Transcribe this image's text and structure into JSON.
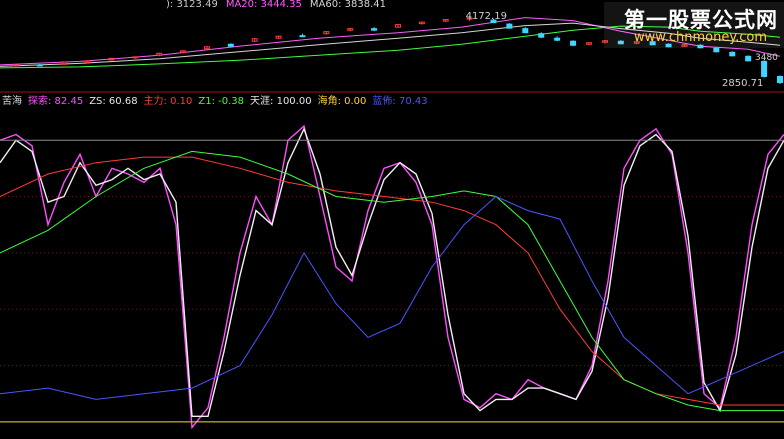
{
  "top_legend": [
    {
      "text": "): 3123.49",
      "color": "#c8c8c8"
    },
    {
      "text": "MA20: 3444.35",
      "color": "#ff5bff"
    },
    {
      "text": "MA60: 3838.41",
      "color": "#d6d6d6"
    }
  ],
  "price_labels": {
    "peak": "4172.19",
    "right_mid": "3480",
    "low": "2850.71"
  },
  "indicator_legend": [
    {
      "text": "苦海",
      "color": "#d8d8d8"
    },
    {
      "text": "探索: 82.45",
      "color": "#ff4dff"
    },
    {
      "text": "ZS: 60.68",
      "color": "#e6e6e6"
    },
    {
      "text": "主力: 0.10",
      "color": "#ff3b3b"
    },
    {
      "text": "Z1: -0.38",
      "color": "#3cff3c"
    },
    {
      "text": "天涯: 100.00",
      "color": "#e6e6e6"
    },
    {
      "text": "海角: 0.00",
      "color": "#ffd23c"
    },
    {
      "text": "蓝佈: 70.43",
      "color": "#4a55ff"
    }
  ],
  "watermark": {
    "title": "第一股票公式网",
    "url": "www.chnmoney.com"
  },
  "chart_data": [
    {
      "type": "line",
      "panel": "price",
      "ylim": [
        2850,
        4400
      ],
      "xlim": [
        0,
        98
      ],
      "grid": false,
      "series": [
        {
          "name": "MA20",
          "color": "#ff5bff",
          "x": [
            0,
            10,
            20,
            30,
            40,
            50,
            58,
            66,
            72,
            78,
            84,
            88,
            94,
            98
          ],
          "y": [
            3230,
            3300,
            3420,
            3600,
            3760,
            3870,
            3980,
            4170,
            4110,
            3900,
            3720,
            3600,
            3540,
            3400
          ]
        },
        {
          "name": "MA60",
          "color": "#d6d6d6",
          "x": [
            0,
            10,
            20,
            30,
            40,
            50,
            58,
            66,
            72,
            78,
            84,
            88,
            94,
            98
          ],
          "y": [
            3200,
            3260,
            3350,
            3490,
            3630,
            3760,
            3870,
            4010,
            4060,
            3950,
            3860,
            3760,
            3680,
            3620
          ]
        },
        {
          "color": "#3cff3c",
          "x": [
            0,
            10,
            20,
            30,
            40,
            50,
            58,
            66,
            72,
            78,
            84,
            88,
            94,
            98
          ],
          "y": [
            3170,
            3190,
            3250,
            3320,
            3420,
            3520,
            3640,
            3800,
            3920,
            4000,
            3980,
            3900,
            3840,
            3780
          ]
        }
      ],
      "candles": [
        [
          2,
          3210,
          3240,
          3190,
          3230
        ],
        [
          5,
          3230,
          3250,
          3200,
          3215
        ],
        [
          8,
          3240,
          3300,
          3230,
          3290
        ],
        [
          11,
          3280,
          3320,
          3260,
          3310
        ],
        [
          14,
          3330,
          3370,
          3320,
          3360
        ],
        [
          17,
          3380,
          3400,
          3350,
          3390
        ],
        [
          20,
          3420,
          3470,
          3400,
          3460
        ],
        [
          23,
          3480,
          3520,
          3460,
          3510
        ],
        [
          26,
          3550,
          3600,
          3540,
          3590
        ],
        [
          29,
          3640,
          3660,
          3580,
          3600
        ],
        [
          32,
          3700,
          3760,
          3690,
          3750
        ],
        [
          35,
          3760,
          3810,
          3750,
          3800
        ],
        [
          38,
          3810,
          3850,
          3780,
          3790
        ],
        [
          41,
          3850,
          3900,
          3830,
          3890
        ],
        [
          44,
          3920,
          3960,
          3900,
          3950
        ],
        [
          47,
          3950,
          3980,
          3900,
          3920
        ],
        [
          50,
          3980,
          4040,
          3970,
          4030
        ],
        [
          53,
          4050,
          4090,
          4030,
          4080
        ],
        [
          56,
          4100,
          4140,
          4080,
          4130
        ],
        [
          59,
          4140,
          4172,
          4100,
          4160
        ],
        [
          62,
          4120,
          4150,
          4060,
          4070
        ],
        [
          64,
          4040,
          4060,
          3950,
          3960
        ],
        [
          66,
          3950,
          3980,
          3860,
          3870
        ],
        [
          68,
          3850,
          3880,
          3760,
          3780
        ],
        [
          70,
          3760,
          3800,
          3700,
          3720
        ],
        [
          72,
          3700,
          3720,
          3600,
          3620
        ],
        [
          74,
          3640,
          3680,
          3620,
          3670
        ],
        [
          76,
          3680,
          3720,
          3660,
          3710
        ],
        [
          78,
          3700,
          3720,
          3640,
          3650
        ],
        [
          80,
          3660,
          3700,
          3640,
          3690
        ],
        [
          82,
          3690,
          3710,
          3620,
          3630
        ],
        [
          84,
          3640,
          3660,
          3580,
          3590
        ],
        [
          86,
          3600,
          3640,
          3590,
          3630
        ],
        [
          88,
          3620,
          3640,
          3560,
          3570
        ],
        [
          90,
          3560,
          3580,
          3480,
          3490
        ],
        [
          92,
          3480,
          3500,
          3400,
          3410
        ],
        [
          94,
          3400,
          3420,
          3300,
          3310
        ],
        [
          96,
          3300,
          3320,
          2980,
          3000
        ],
        [
          98,
          3000,
          3020,
          2850,
          2880
        ]
      ]
    },
    {
      "type": "line",
      "panel": "indicator",
      "ylim": [
        -5,
        110
      ],
      "xlim": [
        0,
        98
      ],
      "grid": true,
      "series": [
        {
          "name": "探索",
          "color": "#ff4dff",
          "x": [
            0,
            2,
            4,
            6,
            8,
            10,
            12,
            14,
            16,
            18,
            20,
            22,
            24,
            26,
            28,
            30,
            32,
            34,
            36,
            38,
            40,
            42,
            44,
            46,
            48,
            50,
            52,
            54,
            56,
            58,
            60,
            62,
            64,
            66,
            68,
            70,
            72,
            74,
            76,
            78,
            80,
            82,
            84,
            86,
            88,
            90,
            92,
            94,
            96,
            98
          ],
          "y": [
            100,
            102,
            98,
            70,
            85,
            95,
            80,
            90,
            88,
            85,
            90,
            70,
            -2,
            5,
            30,
            60,
            80,
            70,
            100,
            105,
            80,
            55,
            50,
            75,
            90,
            92,
            85,
            70,
            30,
            8,
            5,
            10,
            8,
            15,
            12,
            10,
            8,
            20,
            50,
            90,
            100,
            104,
            95,
            60,
            10,
            5,
            30,
            70,
            95,
            102
          ]
        },
        {
          "name": "ZS",
          "color": "#f0f0f0",
          "x": [
            0,
            2,
            4,
            6,
            8,
            10,
            12,
            14,
            16,
            18,
            20,
            22,
            24,
            26,
            28,
            30,
            32,
            34,
            36,
            38,
            40,
            42,
            44,
            46,
            48,
            50,
            52,
            54,
            56,
            58,
            60,
            62,
            64,
            66,
            68,
            70,
            72,
            74,
            76,
            78,
            80,
            82,
            84,
            86,
            88,
            90,
            92,
            94,
            96,
            98
          ],
          "y": [
            92,
            100,
            96,
            78,
            80,
            92,
            84,
            86,
            90,
            86,
            88,
            78,
            2,
            2,
            25,
            52,
            75,
            70,
            92,
            104,
            88,
            62,
            52,
            70,
            86,
            92,
            88,
            74,
            38,
            10,
            4,
            8,
            8,
            12,
            12,
            10,
            8,
            18,
            44,
            84,
            98,
            102,
            96,
            66,
            14,
            4,
            24,
            62,
            90,
            100
          ]
        },
        {
          "name": "主力",
          "color": "#ff3b3b",
          "x": [
            0,
            6,
            12,
            18,
            24,
            30,
            36,
            42,
            48,
            54,
            58,
            62,
            66,
            70,
            74,
            78,
            82,
            86,
            90,
            94,
            98
          ],
          "y": [
            80,
            88,
            92,
            94,
            94,
            90,
            85,
            82,
            80,
            78,
            75,
            70,
            60,
            40,
            25,
            15,
            10,
            8,
            6,
            6,
            6
          ]
        },
        {
          "name": "Z1",
          "color": "#3cff3c",
          "x": [
            0,
            6,
            12,
            18,
            24,
            30,
            36,
            42,
            48,
            54,
            58,
            62,
            66,
            70,
            74,
            78,
            82,
            86,
            90,
            94,
            98
          ],
          "y": [
            60,
            68,
            80,
            90,
            96,
            94,
            88,
            80,
            78,
            80,
            82,
            80,
            70,
            50,
            30,
            15,
            10,
            6,
            4,
            4,
            4
          ]
        },
        {
          "name": "蓝佈",
          "color": "#4a55ff",
          "x": [
            0,
            6,
            12,
            18,
            24,
            30,
            34,
            38,
            42,
            46,
            50,
            54,
            58,
            62,
            66,
            70,
            74,
            78,
            82,
            86,
            90,
            94,
            98
          ],
          "y": [
            10,
            12,
            8,
            10,
            12,
            20,
            38,
            60,
            42,
            30,
            35,
            55,
            70,
            80,
            75,
            72,
            50,
            30,
            20,
            10,
            15,
            20,
            25
          ]
        },
        {
          "name": "天涯",
          "color": "#888888",
          "x": [
            0,
            98
          ],
          "y": [
            100,
            100
          ]
        },
        {
          "name": "海角",
          "color": "#ffd23c",
          "x": [
            0,
            98
          ],
          "y": [
            0,
            0
          ]
        }
      ]
    }
  ]
}
